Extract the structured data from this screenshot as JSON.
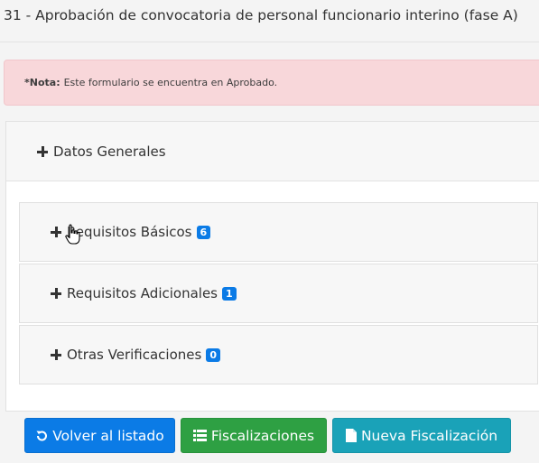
{
  "page": {
    "title": "31 - Aprobación de convocatoria de personal funcionario interino (fase A)"
  },
  "alert": {
    "label": "*Nota:",
    "message": "Este formulario se encuentra en Aprobado."
  },
  "accordion": {
    "header_label": "Datos Generales",
    "panels": [
      {
        "label": "Requisitos Básicos",
        "badge": "6"
      },
      {
        "label": "Requisitos Adicionales",
        "badge": "1"
      },
      {
        "label": "Otras Verificaciones",
        "badge": "0"
      }
    ]
  },
  "buttons": {
    "back": "Volver al listado",
    "fiscalizaciones": "Fiscalizaciones",
    "nueva": "Nueva Fiscalización"
  },
  "colors": {
    "primary": "#0b7be6",
    "success": "#2ea043",
    "info": "#1aa2b8",
    "alert_bg": "#f8d7da"
  },
  "icons": [
    "plus-icon",
    "hand-cursor-icon",
    "undo-icon",
    "list-icon",
    "file-icon"
  ]
}
